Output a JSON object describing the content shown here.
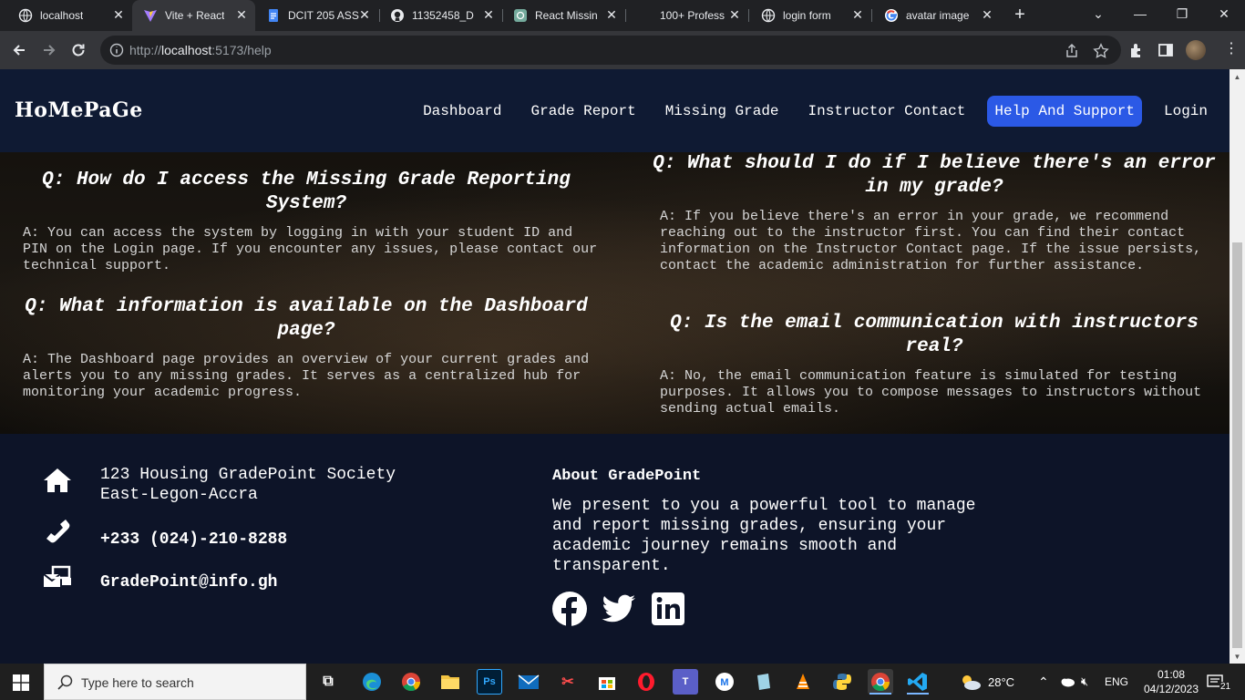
{
  "browser": {
    "tabs": [
      {
        "title": "localhost",
        "icon": "globe-icon",
        "active": false
      },
      {
        "title": "Vite + React",
        "icon": "vite-icon",
        "active": true
      },
      {
        "title": "DCIT 205 ASS",
        "icon": "docs-icon",
        "active": false
      },
      {
        "title": "11352458_D",
        "icon": "github-icon",
        "active": false
      },
      {
        "title": "React Missin",
        "icon": "chatgpt-icon",
        "active": false
      },
      {
        "title": "100+ Profess",
        "icon": "blank-icon",
        "active": false
      },
      {
        "title": "login form",
        "icon": "globe-icon",
        "active": false
      },
      {
        "title": "avatar image",
        "icon": "google-icon",
        "active": false
      }
    ],
    "url_prefix": "http://",
    "url_host": "localhost",
    "url_rest": ":5173/help"
  },
  "site": {
    "brand": "HoMePaGe",
    "nav": [
      {
        "label": "Dashboard",
        "active": false
      },
      {
        "label": "Grade Report",
        "active": false
      },
      {
        "label": "Missing Grade",
        "active": false
      },
      {
        "label": "Instructor Contact",
        "active": false
      },
      {
        "label": "Help And Support",
        "active": true
      },
      {
        "label": "Login",
        "active": false
      }
    ],
    "active_color": "#2b59e6"
  },
  "faq": {
    "left": [
      {
        "q": "Q: How do I access the Missing Grade Reporting System?",
        "a": "A: You can access the system by logging in with your student ID and PIN on the Login page. If you encounter any issues, please contact our technical support."
      },
      {
        "q": "Q: What information is available on the Dashboard page?",
        "a": "A: The Dashboard page provides an overview of your current grades and alerts you to any missing grades. It serves as a centralized hub for monitoring your academic progress."
      }
    ],
    "right": [
      {
        "q": "Q: What should I do if I believe there's an error in my grade?",
        "a": "A: If you believe there's an error in your grade, we recommend reaching out to the instructor first. You can find their contact information on the Instructor Contact page. If the issue persists, contact the academic administration for further assistance."
      },
      {
        "q": "Q: Is the email communication with instructors real?",
        "a": "A: No, the email communication feature is simulated for testing purposes. It allows you to compose messages to instructors without sending actual emails."
      }
    ]
  },
  "footer": {
    "address_line1": "123 Housing GradePoint Society",
    "address_line2": "East-Legon-Accra",
    "phone": "+233 (024)-210-8288",
    "email": "GradePoint@info.gh",
    "about_title": "About GradePoint",
    "about_text": "We present to you a powerful tool to manage and report missing grades, ensuring your academic journey remains smooth and transparent.",
    "social": [
      "facebook-icon",
      "twitter-icon",
      "linkedin-icon"
    ]
  },
  "taskbar": {
    "search_placeholder": "Type here to search",
    "weather": "28°C",
    "lang": "ENG",
    "time": "01:08",
    "date": "04/12/2023",
    "notifications": "21"
  }
}
